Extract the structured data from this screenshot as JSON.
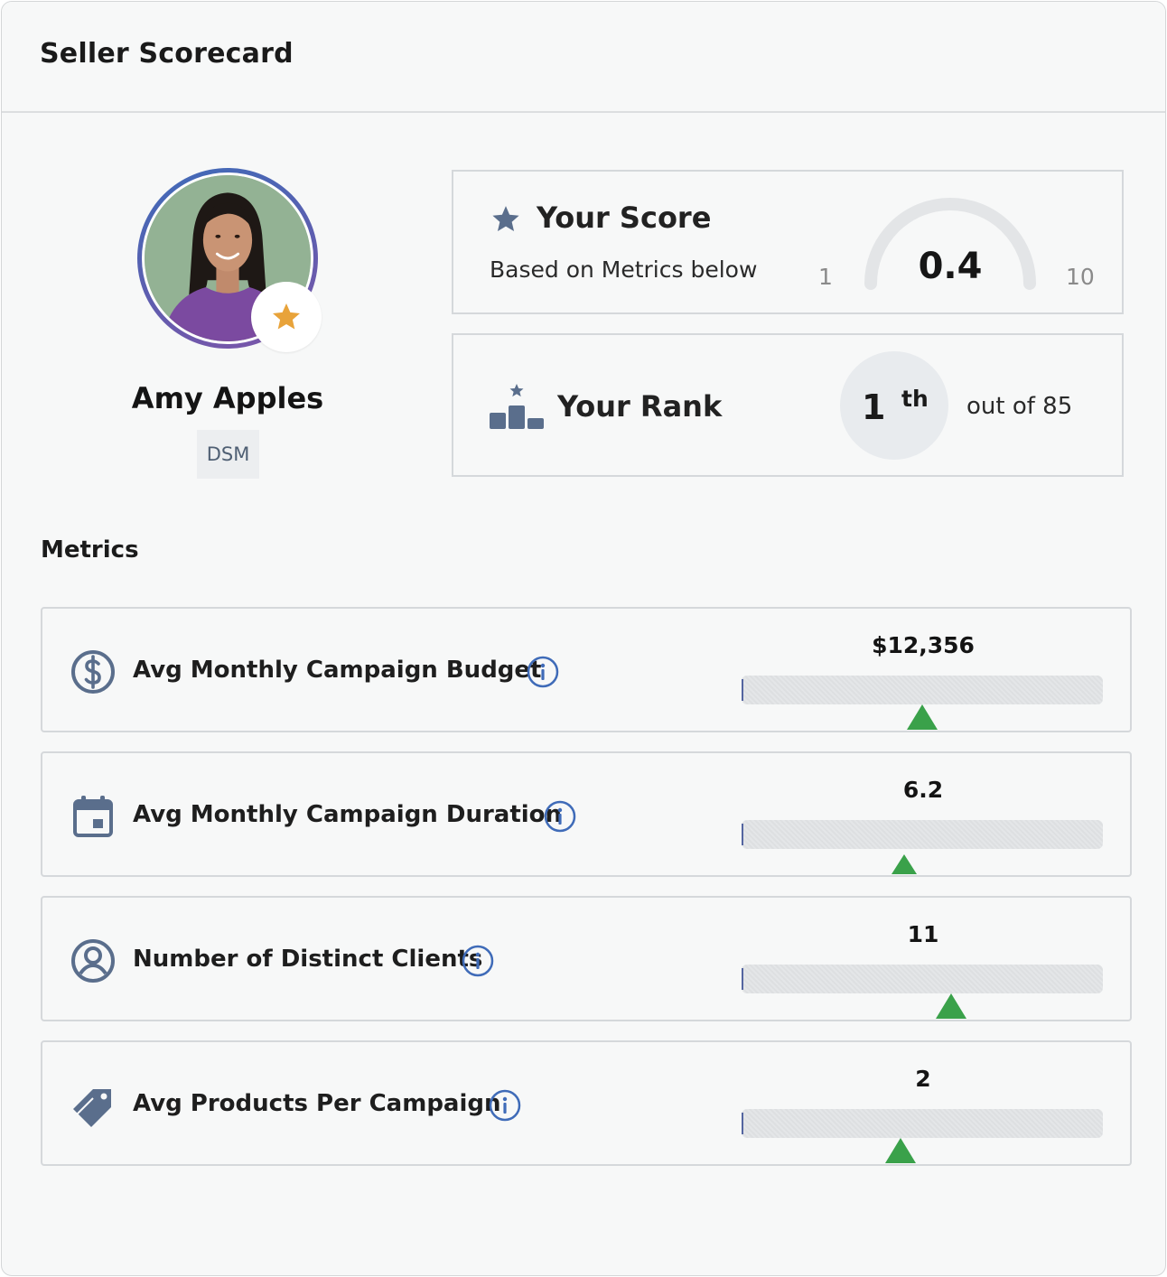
{
  "header": {
    "title": "Seller Scorecard"
  },
  "profile": {
    "name": "Amy Apples",
    "role": "DSM",
    "avatar_icon": "user-photo",
    "badge_icon": "star-icon",
    "badge_color": "#e8a33a"
  },
  "score": {
    "title": "Your Score",
    "subtitle": "Based on Metrics below",
    "value": "0.4",
    "min": "1",
    "max": "10",
    "icon": "star-icon"
  },
  "rank": {
    "title": "Your Rank",
    "number": "1",
    "suffix": "th",
    "out_of": "out of 85",
    "icon": "podium-icon"
  },
  "metrics": {
    "heading": "Metrics",
    "items": [
      {
        "label": "Avg Monthly Campaign Budget",
        "value": "$12,356",
        "icon": "dollar-circle-icon",
        "marker_position": 0.5,
        "marker_size": "large"
      },
      {
        "label": "Avg Monthly Campaign Duration",
        "value": "6.2",
        "icon": "calendar-icon",
        "marker_position": 0.45,
        "marker_size": "small"
      },
      {
        "label": "Number of Distinct Clients",
        "value": "11",
        "icon": "user-circle-icon",
        "marker_position": 0.58,
        "marker_size": "large"
      },
      {
        "label": "Avg Products Per Campaign",
        "value": "2",
        "icon": "tag-icon",
        "marker_position": 0.44,
        "marker_size": "large"
      }
    ]
  },
  "colors": {
    "accent": "#3f6bb8",
    "icon": "#5a6e8c",
    "marker": "#3aa14a",
    "info": "#3f6bb8"
  }
}
